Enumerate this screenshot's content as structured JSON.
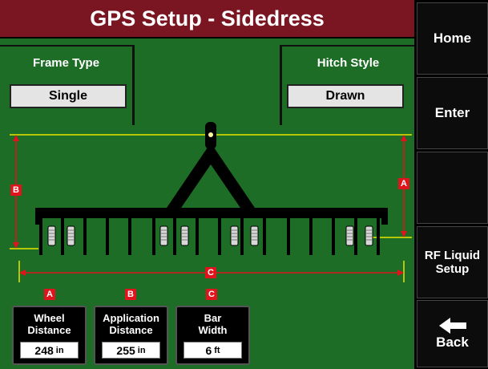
{
  "title": "GPS Setup - Sidedress",
  "frame_type": {
    "label": "Frame Type",
    "value": "Single"
  },
  "hitch_style": {
    "label": "Hitch Style",
    "value": "Drawn"
  },
  "markers": {
    "a": "A",
    "b": "B",
    "c": "C"
  },
  "measurements": {
    "wheel": {
      "tag": "A",
      "label_line1": "Wheel",
      "label_line2": "Distance",
      "value": "248",
      "unit": "in"
    },
    "application": {
      "tag": "B",
      "label_line1": "Application",
      "label_line2": "Distance",
      "value": "255",
      "unit": "in"
    },
    "bar": {
      "tag": "C",
      "label_line1": "Bar",
      "label_line2": "Width",
      "value": "6",
      "unit": "ft"
    }
  },
  "sidebar": {
    "home": "Home",
    "enter": "Enter",
    "rf_line1": "RF Liquid",
    "rf_line2": "Setup",
    "back": "Back"
  },
  "colors": {
    "title_bg": "#7a1622",
    "field_bg": "#1d6d27",
    "guide": "#e6e600",
    "dimension": "#e0141c"
  },
  "icons": {
    "back": "left-arrow-icon"
  }
}
